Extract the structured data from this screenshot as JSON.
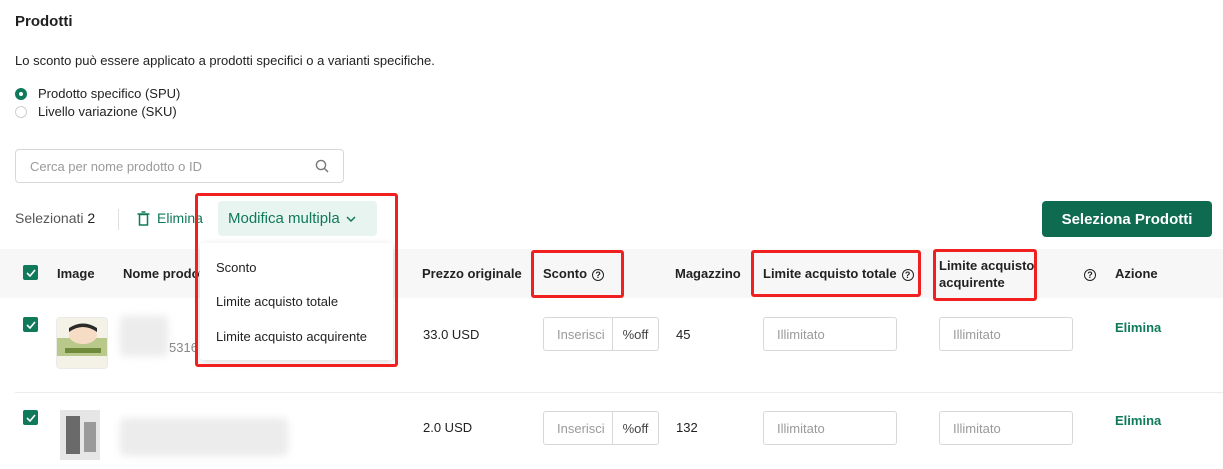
{
  "section": {
    "title": "Prodotti",
    "description": "Lo sconto può essere applicato a prodotti specifici o a varianti specifiche."
  },
  "scope_options": [
    {
      "label": "Prodotto specifico (SPU)",
      "selected": true
    },
    {
      "label": "Livello variazione (SKU)",
      "selected": false
    }
  ],
  "search": {
    "placeholder": "Cerca per nome prodotto o ID",
    "icon": "search-icon"
  },
  "toolbar": {
    "selected_label": "Selezionati",
    "selected_count": "2",
    "delete_label": "Elimina",
    "bulk_edit_label": "Modifica multipla",
    "select_products_label": "Seleziona Prodotti"
  },
  "bulk_menu": {
    "items": [
      "Sconto",
      "Limite acquisto totale",
      "Limite acquisto acquirente"
    ]
  },
  "table": {
    "headers": {
      "image": "Image",
      "name": "Nome prodotto",
      "original_price": "Prezzo originale",
      "discount": "Sconto",
      "stock": "Magazzino",
      "total_limit": "Limite acquisto totale",
      "buyer_limit_line1": "Limite acquisto",
      "buyer_limit_line2": "acquirente",
      "action": "Azione"
    },
    "rows": [
      {
        "id_fragment": "5316",
        "price": "33.0 USD",
        "discount_placeholder": "Inserisci",
        "discount_unit": "%off",
        "stock": "45",
        "total_limit_placeholder": "Illimitato",
        "buyer_limit_placeholder": "Illimitato",
        "action": "Elimina"
      },
      {
        "id_fragment": "",
        "price": "2.0 USD",
        "discount_placeholder": "Inserisci",
        "discount_unit": "%off",
        "stock": "132",
        "total_limit_placeholder": "Illimitato",
        "buyer_limit_placeholder": "Illimitato",
        "action": "Elimina"
      }
    ]
  },
  "colors": {
    "accent": "#0f7a5a",
    "primary_button": "#0e6b50",
    "highlight": "#f02020"
  }
}
